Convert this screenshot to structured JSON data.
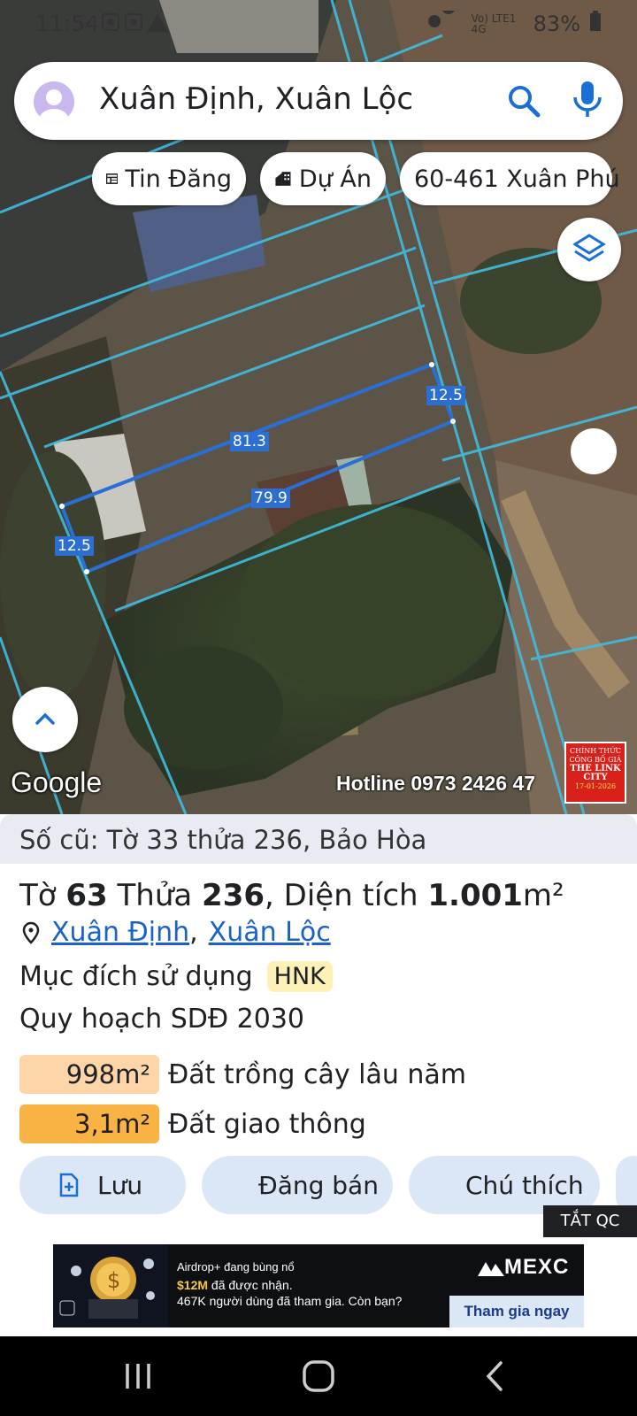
{
  "status_bar": {
    "time": "11:54",
    "network": "Vo) LTE1 4G",
    "battery": "83%"
  },
  "search": {
    "query": "Xuân Định, Xuân Lộc"
  },
  "chips": [
    {
      "label": "Tin Đăng",
      "icon": "calendar-table-icon"
    },
    {
      "label": "Dự Án",
      "icon": "buildings-icon"
    },
    {
      "label": "60-461 Xuân Phú",
      "icon": ""
    }
  ],
  "map": {
    "dimensions": [
      "12.5",
      "81.3",
      "79.9",
      "12.5"
    ],
    "logo": "Google",
    "hotline": "Hotline 0973 2426 47",
    "stamp": {
      "line1": "CHÍNH THỨC",
      "line2": "CÔNG BỐ GIÁ",
      "line3": "THE LINK",
      "line4": "CITY",
      "line5": "17-01-2026"
    }
  },
  "parcel": {
    "old_ref": "Số cũ: Tờ 33 thửa 236, Bảo Hòa",
    "title_prefix": "Tờ ",
    "sheet_no": "63",
    "title_mid": " Thửa ",
    "parcel_no": "236",
    "title_area_label": ", Diện tích ",
    "area_value": "1.001",
    "area_unit": "m²",
    "location_1": "Xuân Định",
    "location_sep": ",",
    "location_2": "Xuân Lộc",
    "purpose_label": "Mục đích sử dụng",
    "purpose_code": "HNK",
    "plan_label": "Quy hoạch SDĐ 2030",
    "land_uses": [
      {
        "area": "998m²",
        "label": "Đất trồng cây lâu năm",
        "color": "#fdd5a8"
      },
      {
        "area": "3,1m²",
        "label": "Đất giao thông",
        "color": "#f9b344"
      }
    ]
  },
  "actions": {
    "save": "Lưu",
    "post_sale": "Đăng bán",
    "legend": "Chú thích"
  },
  "ad": {
    "close_label": "TẮT QC",
    "line1": "Airdrop+ đang bùng nổ",
    "line2_amount": "$12M",
    "line2_rest": " đã được nhận.",
    "line3": "467K người dùng đã tham gia. Còn bạn?",
    "brand": "MEXC",
    "cta": "Tham gia ngay"
  }
}
